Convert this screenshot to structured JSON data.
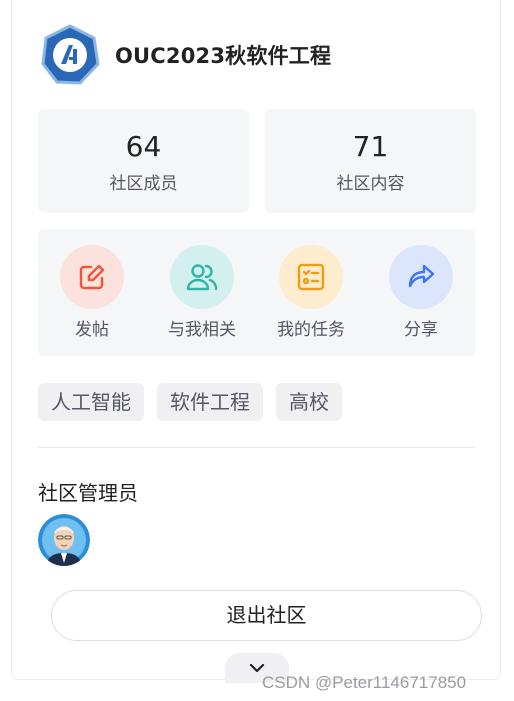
{
  "community": {
    "name": "OUC2023秋软件工程"
  },
  "stats": [
    {
      "value": "64",
      "label": "社区成员"
    },
    {
      "value": "71",
      "label": "社区内容"
    }
  ],
  "actions": [
    {
      "label": "发帖",
      "icon": "edit-icon",
      "color": "#f0563a",
      "bg": "#fbe2dc"
    },
    {
      "label": "与我相关",
      "icon": "users-icon",
      "color": "#2fb5a8",
      "bg": "#d4f0ee"
    },
    {
      "label": "我的任务",
      "icon": "task-list-icon",
      "color": "#f39c12",
      "bg": "#fdeccd"
    },
    {
      "label": "分享",
      "icon": "share-icon",
      "color": "#3f74f3",
      "bg": "#dbe6fd"
    }
  ],
  "tags": [
    "人工智能",
    "软件工程",
    "高校"
  ],
  "admin": {
    "title": "社区管理员"
  },
  "exit_button": "退出社区",
  "watermark": "CSDN @Peter1146717850"
}
